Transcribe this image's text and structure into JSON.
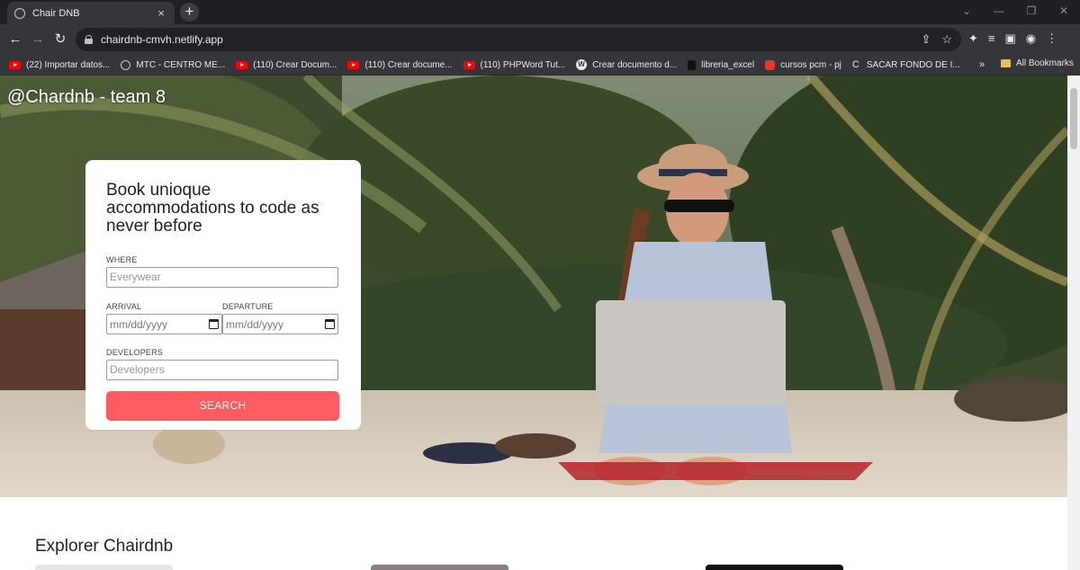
{
  "browser": {
    "tab_title": "Chair DNB",
    "tab_close": "×",
    "new_tab": "+",
    "url": "chairdnb-cmvh.netlify.app",
    "window_controls": [
      "⌄",
      "—",
      "❐",
      "✕"
    ],
    "bookmarks": [
      {
        "label": "(22) Importar datos...",
        "icon": "youtube-icon"
      },
      {
        "label": "MTC - CENTRO ME...",
        "icon": "globe-icon"
      },
      {
        "label": "(110) Crear Docum...",
        "icon": "youtube-icon"
      },
      {
        "label": "(110) Crear docume...",
        "icon": "youtube-icon"
      },
      {
        "label": "(110) PHPWord Tut...",
        "icon": "youtube-icon"
      },
      {
        "label": "Crear documento d...",
        "icon": "wordpress-icon"
      },
      {
        "label": "libreria_excel",
        "icon": "bookmark-icon"
      },
      {
        "label": "cursos pcm - pj",
        "icon": "site-icon"
      },
      {
        "label": "SACAR FONDO DE I...",
        "icon": "c-icon"
      }
    ],
    "bookmarks_more": "»",
    "all_bookmarks": "All Bookmarks"
  },
  "page": {
    "brand": "@Chardnb - team 8",
    "form": {
      "heading": "Book unioque accommodations to code as never before",
      "where_label": "WHERE",
      "where_placeholder": "Everywear",
      "arrival_label": "ARRIVAL",
      "arrival_placeholder": "mm/dd/yyyy",
      "departure_label": "DEPARTURE",
      "departure_placeholder": "mm/dd/yyyy",
      "developers_label": "DEVELOPERS",
      "developers_placeholder": "Developers",
      "search_label": "SEARCH"
    },
    "section_title": "Explorer Chairdnb"
  },
  "colors": {
    "accent": "#fd5c63",
    "chrome_dark": "#35363a",
    "tabbar": "#1f2023"
  }
}
